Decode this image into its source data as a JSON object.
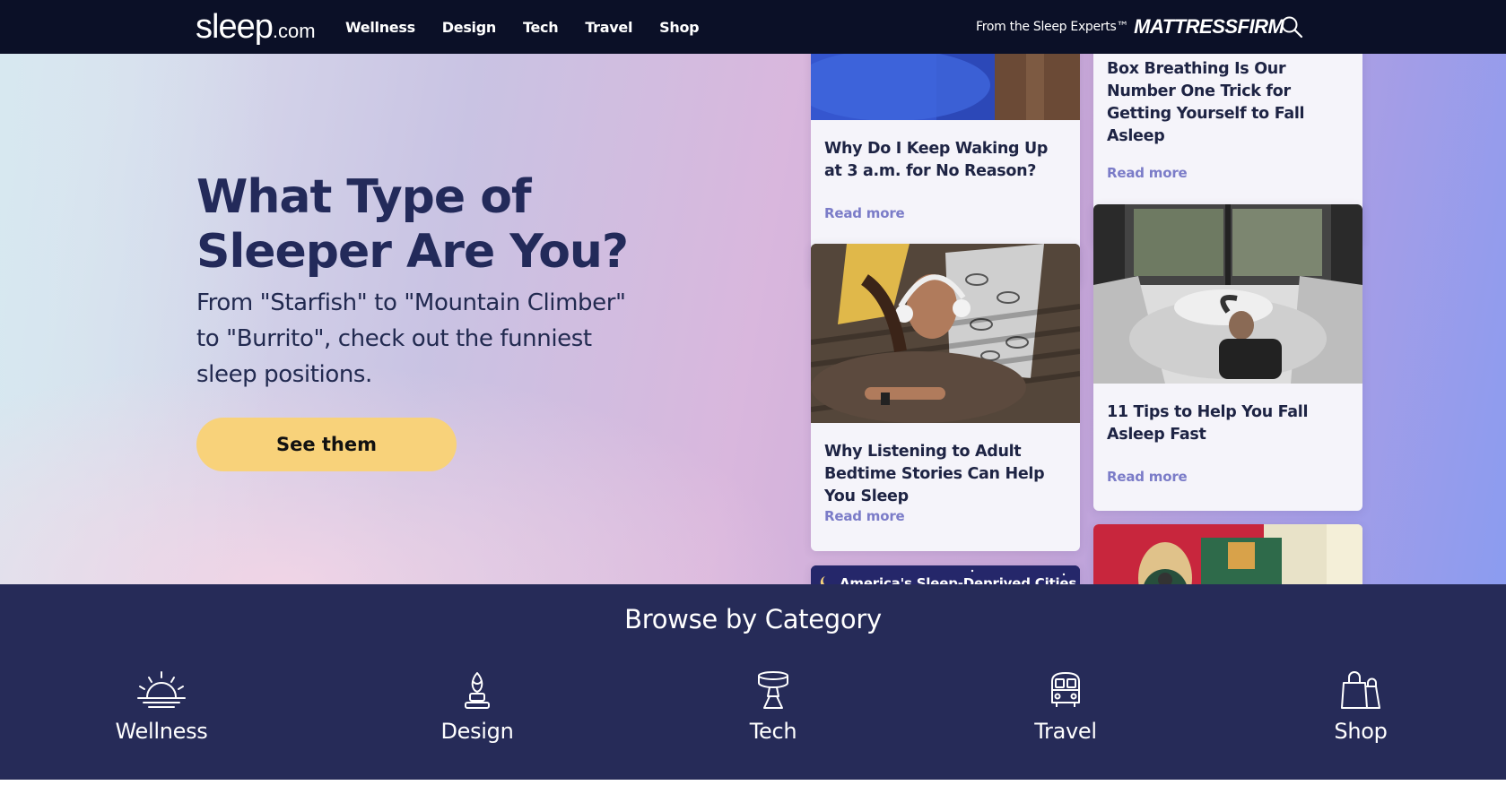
{
  "header": {
    "logo_main": "sleep",
    "logo_tld": ".com",
    "nav": [
      "Wellness",
      "Design",
      "Tech",
      "Travel",
      "Shop"
    ],
    "tagline": "From the Sleep Experts™",
    "partner": "MATTRESSFIRM",
    "search_icon": "search-icon"
  },
  "hero": {
    "title": "What Type of Sleeper Are You?",
    "subtitle": "From \"Starfish\" to \"Mountain Climber\" to \"Burrito\", check out the funniest sleep positions.",
    "cta": "See them"
  },
  "cards": [
    {
      "title": "Why Do I Keep Waking Up at 3 a.m. for No Reason?",
      "link": "Read more"
    },
    {
      "title": "Box Breathing Is Our Number One Trick for Getting Yourself to Fall Asleep",
      "link": "Read more"
    },
    {
      "title": "Why Listening to Adult Bedtime Stories Can Help You Sleep",
      "link": "Read more"
    },
    {
      "title": "11 Tips to Help You Fall Asleep Fast",
      "link": "Read more"
    },
    {
      "image_text": "America's Sleep-Deprived Cities"
    }
  ],
  "browse": {
    "title": "Browse by Category",
    "categories": [
      {
        "label": "Wellness",
        "icon": "sunrise-icon"
      },
      {
        "label": "Design",
        "icon": "lamp-icon"
      },
      {
        "label": "Tech",
        "icon": "smart-lamp-icon"
      },
      {
        "label": "Travel",
        "icon": "van-icon"
      },
      {
        "label": "Shop",
        "icon": "shopping-bags-icon"
      }
    ]
  },
  "colors": {
    "header_bg": "#0b1027",
    "title_navy": "#232a5a",
    "cta_yellow": "#f8d27a",
    "link_purple": "#7b7cc8",
    "browse_bg": "#262b58"
  }
}
